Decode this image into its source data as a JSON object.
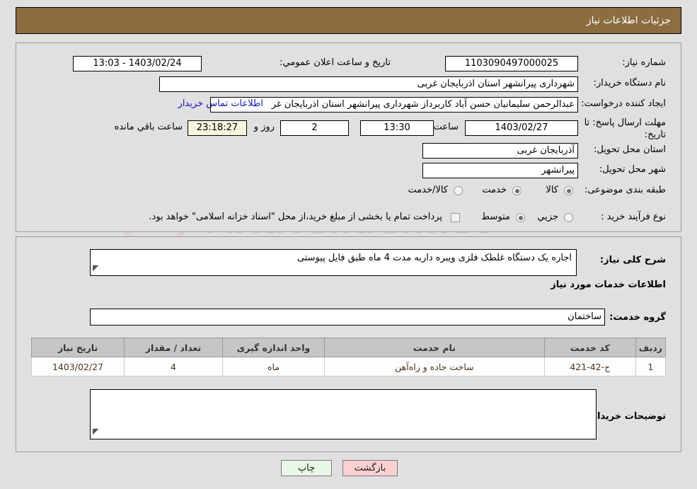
{
  "header": {
    "title": "جزئیات اطلاعات نیاز"
  },
  "top_form": {
    "labels": {
      "need_number": "شماره نیاز:",
      "buyer_org": "نام دستگاه خریدار:",
      "request_creator": "ایجاد کننده درخواست:",
      "response_deadline": "مهلت ارسال پاسخ: تا تاریخ:",
      "delivery_province": "استان محل تحویل:",
      "delivery_city": "شهر محل تحویل:",
      "subject_category": "طبقه بندی موضوعی:",
      "purchase_process_type": "نوع فرآیند خرید :",
      "public_announce_datetime": "تاریخ و ساعت اعلان عمومي:",
      "hour": "ساعت",
      "day_and": "روز و",
      "hours_remaining": "ساعت باقي مانده"
    },
    "values": {
      "need_number": "1103090497000025",
      "buyer_org": "شهرداری پیرانشهر استان اذربایجان غربی",
      "request_creator": "عبدالرحمن سلیمانیان حسن آباد کاربرداز شهرداری پیرانشهر استان اذربایجان غر",
      "contact_link": "اطلاعات تماس خریدار",
      "response_deadline_date": "1403/02/27",
      "response_deadline_hour": "13:30",
      "remaining_days": "2",
      "remaining_time": "23:18:27",
      "public_announce_datetime": "1403/02/24 - 13:03",
      "delivery_province": "آذربایجان غربی",
      "delivery_city": "پیرانشهر"
    },
    "subject_category_options": [
      {
        "label": "کالا",
        "selected": false
      },
      {
        "label": "خدمت",
        "selected": true
      },
      {
        "label": "کالا/خدمت",
        "selected": false
      }
    ],
    "process_type_options": [
      {
        "label": "جزیي",
        "selected": false
      },
      {
        "label": "متوسط",
        "selected": true
      }
    ],
    "treasury_note": "پرداخت تمام یا بخشی از مبلغ خرید،از محل \"اسناد خزانه اسلامی\" خواهد بود."
  },
  "middle": {
    "need_description_label": "شرح کلی نیاز:",
    "need_description_value": "اجاره یک دستگاه غلطک فلزی ویبره داربه مدت 4 ماه طبق فایل پیوستی",
    "services_info_heading": "اطلاعات خدمات مورد نیاز",
    "service_group_label": "گروه خدمت:",
    "service_group_value": "ساختمان",
    "buyer_notes_label": "توضیحات خریدار;",
    "buyer_notes_value": ""
  },
  "table": {
    "columns": [
      "ردیف",
      "کد خدمت",
      "نام خدمت",
      "واحد اندازه گیری",
      "تعداد / مقدار",
      "تاریخ نیاز"
    ],
    "rows": [
      {
        "row": "1",
        "service_code": "ج-42-421",
        "service_name": "ساخت جاده و راه‌آهن",
        "unit": "ماه",
        "quantity": "4",
        "need_date": "1403/02/27"
      }
    ]
  },
  "footer": {
    "print_label": "چاپ",
    "back_label": "بازگشت"
  },
  "watermark": {
    "text": "AriaTender.net"
  },
  "colors": {
    "header_bar": "#8c6d3f",
    "page_bg": "#e0e0e0",
    "link": "#1414c8",
    "timer_bg": "#f7f5dc",
    "table_header_bg": "#c6c6c6",
    "back_button_bg": "#fbd0d0",
    "print_button_bg": "#e9f7e5"
  }
}
